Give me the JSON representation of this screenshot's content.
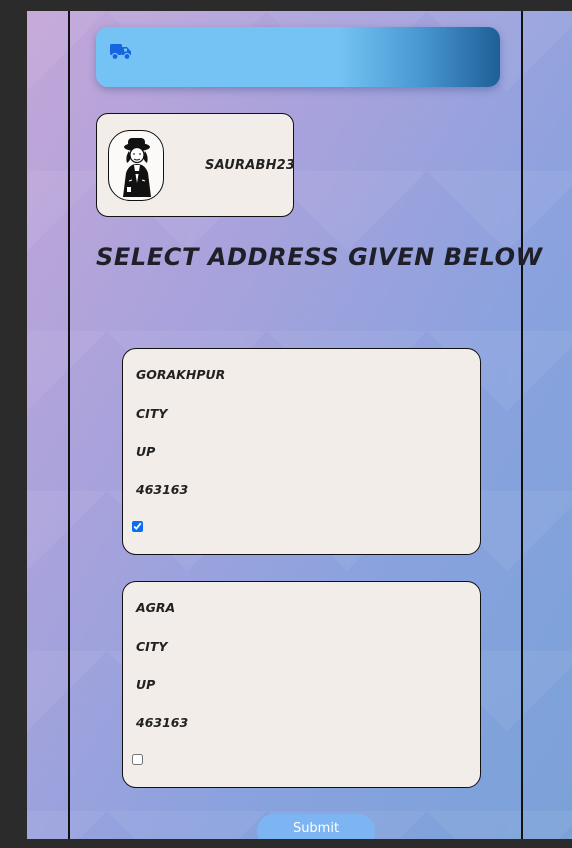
{
  "header": {
    "icon": "truck-icon",
    "color": "#74c3f4"
  },
  "profile": {
    "avatar_icon": "user-avatar-illustration",
    "username": "SAURABH23"
  },
  "heading": "SELECT ADDRESS GIVEN BELOW",
  "addresses": [
    {
      "line1": "GORAKHPUR",
      "line2": "CITY",
      "state": "UP",
      "pincode": "463163",
      "selected": true
    },
    {
      "line1": "AGRA",
      "line2": "CITY",
      "state": "UP",
      "pincode": "463163",
      "selected": false
    }
  ],
  "submit_label": "Submit",
  "colors": {
    "accent": "#0a6cf0",
    "card_bg": "#f2ede8",
    "submit_bg": "#7db4f2"
  }
}
